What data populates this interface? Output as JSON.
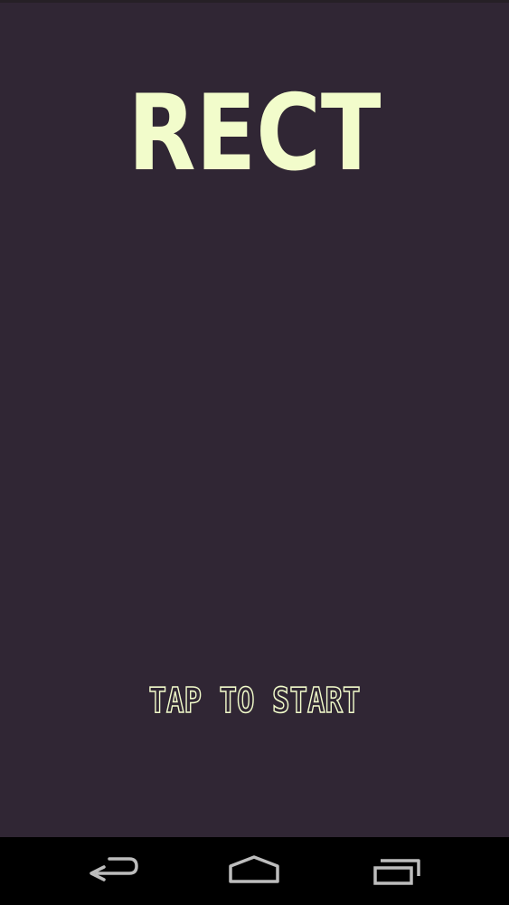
{
  "game": {
    "title": "RECT",
    "prompt": "TAP TO START"
  },
  "colors": {
    "background": "#302634",
    "title": "#F2FCCB",
    "prompt_outline": "#F2FCCB",
    "navbar": "#000000",
    "nav_icon": "#BDBDBD"
  },
  "navigation": {
    "back": "back-icon",
    "home": "home-icon",
    "recents": "recents-icon"
  }
}
